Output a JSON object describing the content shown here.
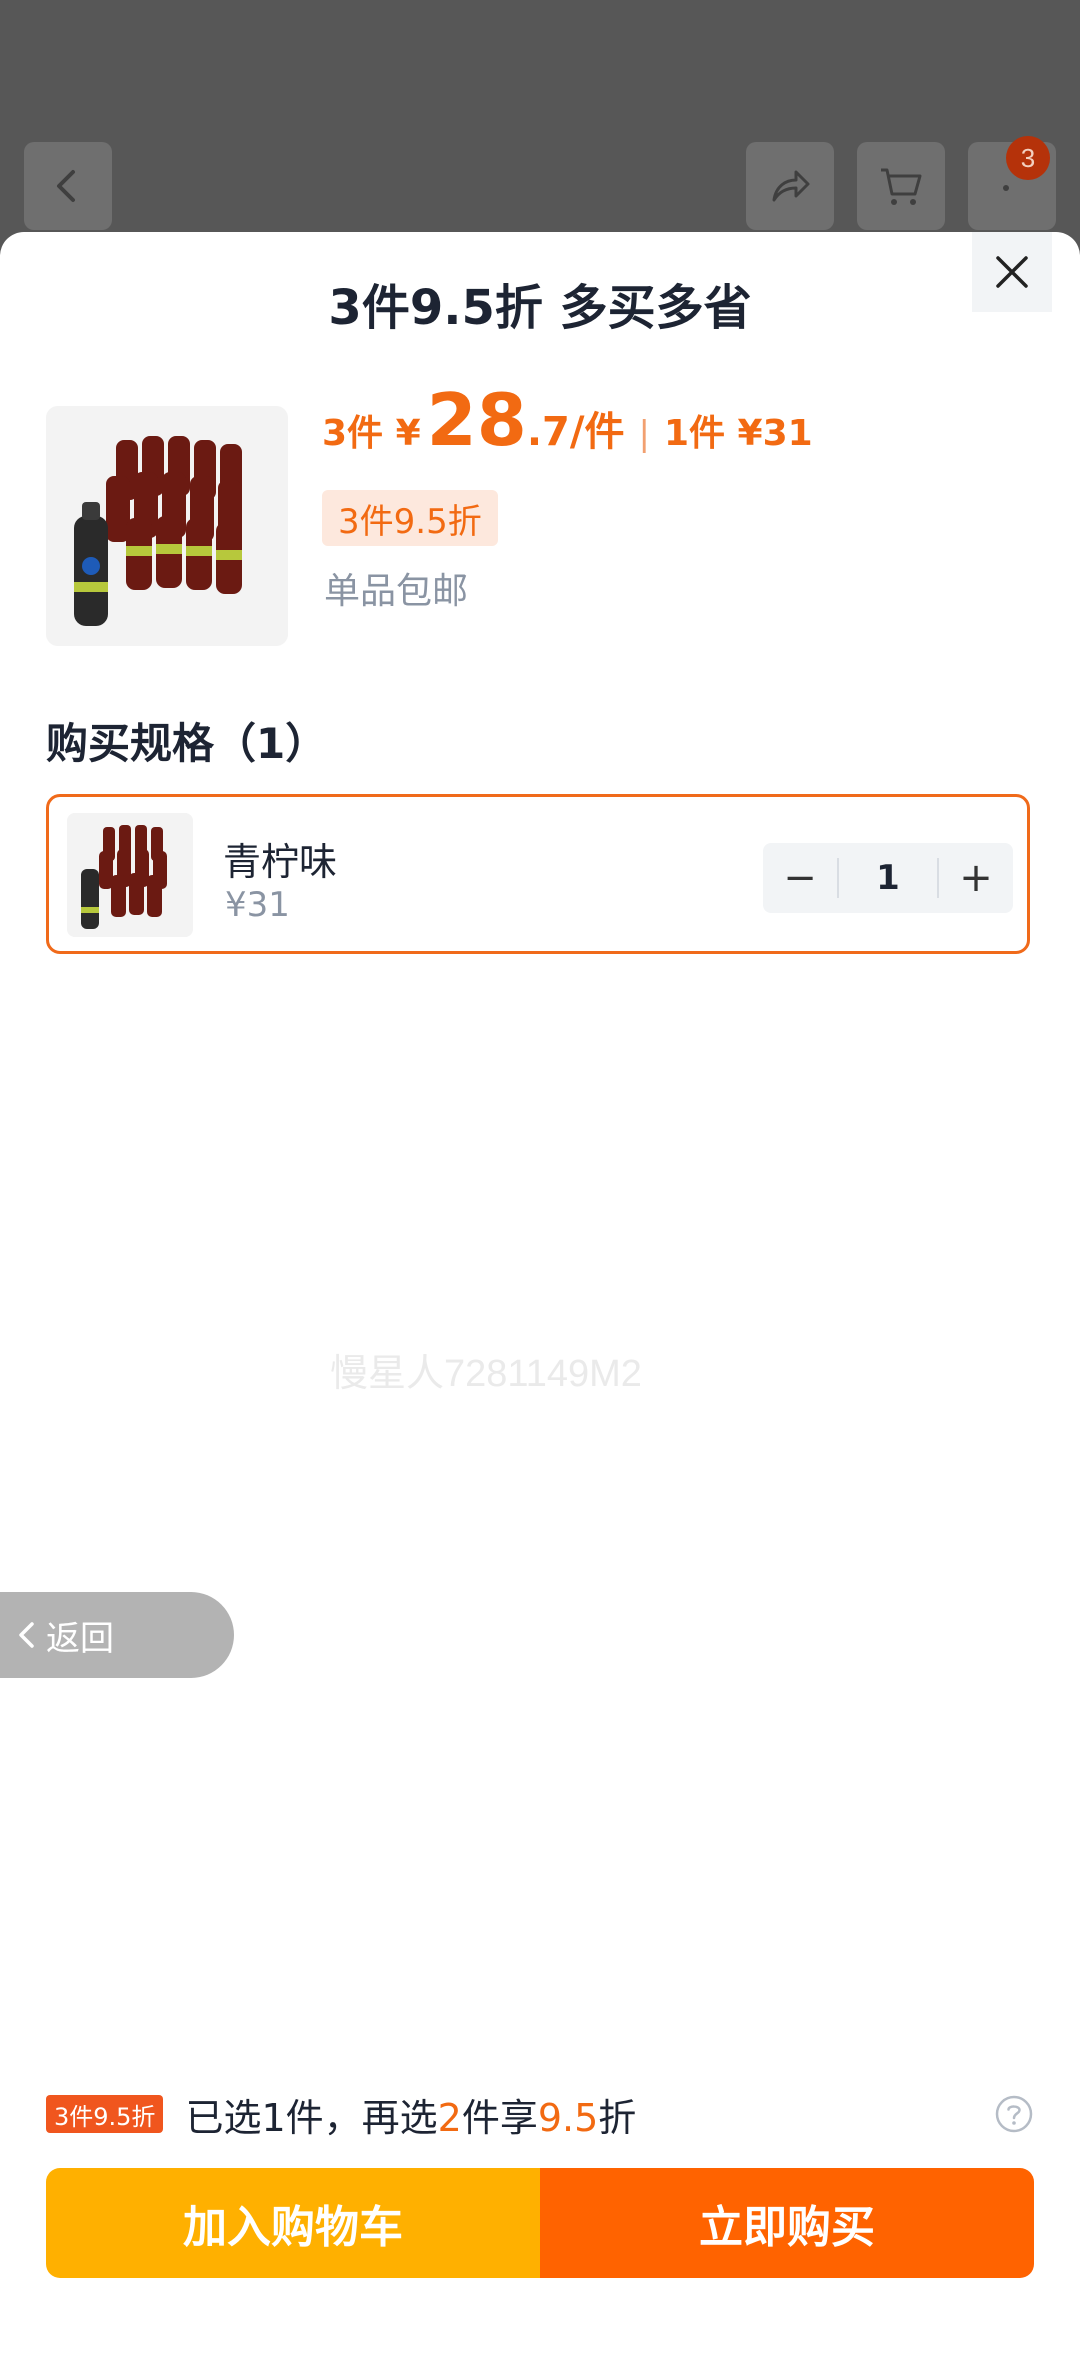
{
  "header": {
    "cart_badge_count": "3",
    "icons": [
      "back-icon",
      "share-icon",
      "cart-icon",
      "more-icon"
    ]
  },
  "sheet": {
    "title": "3件9.5折 多买多省",
    "close_icon": "close-icon",
    "price": {
      "prefix": "3件 ¥",
      "amount_int": "28",
      "amount_dec": ".7/件",
      "single_label": "1件 ¥31"
    },
    "discount_tag": "3件9.5折",
    "shipping": "单品包邮",
    "spec_section_title": "购买规格（1）",
    "spec": {
      "name": "青柠味",
      "price": "¥31",
      "quantity": "1",
      "minus": "−",
      "plus": "+"
    },
    "watermark": "慢星人7281149M2",
    "back_label": "返回",
    "footer": {
      "tag": "3件9.5折",
      "text_a": "已选1件，再选",
      "text_hl1": "2",
      "text_b": "件享",
      "text_hl2": "9.5",
      "text_c": "折"
    },
    "add_to_cart": "加入购物车",
    "buy_now": "立即购买"
  },
  "colors": {
    "accent": "#f26a12",
    "cart_button": "#ffb000",
    "buy_button": "#ff6300",
    "card_border": "#f06a1a"
  }
}
